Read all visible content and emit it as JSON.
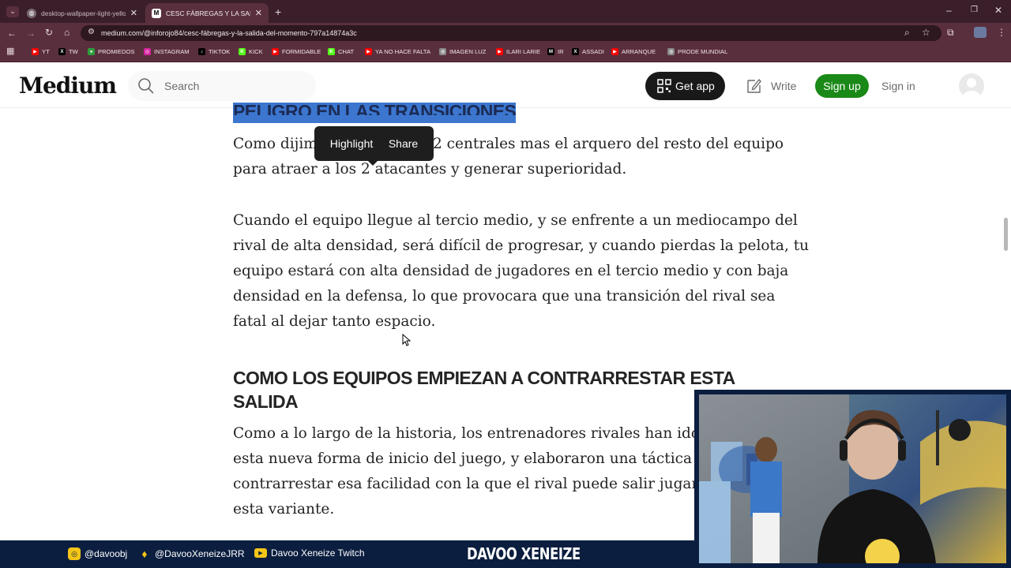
{
  "browser": {
    "tabs": [
      {
        "title": "desktop-wallpaper-light-yellow-aesthetic",
        "active": false
      },
      {
        "title": "CESC FÁBREGAS Y LA SALIDA DEL MOMENTO",
        "active": true
      }
    ],
    "url": "medium.com/@inforojo84/cesc-fábregas-y-la-salida-del-momento-797a14874a3c",
    "bookmarks": [
      {
        "label": "YT",
        "icon": "youtube-icon",
        "color": "#ff0000"
      },
      {
        "label": "TW",
        "icon": "x-icon",
        "color": "#000000"
      },
      {
        "label": "PROMIEDOS",
        "icon": "promiedos-icon",
        "color": "#2e9e3c"
      },
      {
        "label": "INSTAGRAM",
        "icon": "instagram-icon",
        "color": "#d6249f"
      },
      {
        "label": "TIKTOK",
        "icon": "tiktok-icon",
        "color": "#000000"
      },
      {
        "label": "KICK",
        "icon": "kick-icon",
        "color": "#53fc18"
      },
      {
        "label": "FORMIDABLE",
        "icon": "youtube-icon",
        "color": "#ff0000"
      },
      {
        "label": "CHAT",
        "icon": "kick-icon",
        "color": "#53fc18"
      },
      {
        "label": "YA NO HACE FALTA",
        "icon": "youtube-icon",
        "color": "#ff0000"
      },
      {
        "label": "IMAGEN LUZ",
        "icon": "globe-icon",
        "color": "#888888"
      },
      {
        "label": "ILARI LARIE",
        "icon": "youtube-icon",
        "color": "#ff0000"
      },
      {
        "label": "IR",
        "icon": "medium-icon",
        "color": "#000000"
      },
      {
        "label": "ASSADI",
        "icon": "x-icon",
        "color": "#000000"
      },
      {
        "label": "ARRANQUE",
        "icon": "youtube-icon",
        "color": "#ff0000"
      },
      {
        "label": "PRODE MUNDIAL",
        "icon": "globe-icon",
        "color": "#888888"
      }
    ]
  },
  "medium": {
    "logo": "Medium",
    "search_placeholder": "Search",
    "get_app": "Get app",
    "write": "Write",
    "sign_up": "Sign up",
    "sign_in": "Sign in",
    "brand_green": "#1a8917"
  },
  "article": {
    "highlighted_heading": "PELIGRO EN LAS TRANSICIONES",
    "popover": {
      "highlight": "Highlight",
      "share": "Share"
    },
    "p1": [
      "Como dijimos, se separan los 2 centrales mas el arquero del resto del equipo",
      "para atraer a los 2 atacantes y generar superioridad."
    ],
    "p1_visible_start": "Como dijim",
    "p1_visible_end": " 2 centrales mas el arquero del resto del equipo",
    "p2": [
      "Cuando el equipo llegue al tercio medio, y se enfrente a un mediocampo del",
      "rival de alta densidad, será difícil de progresar, y cuando pierdas la pelota, tu",
      "equipo estará con alta densidad de jugadores en el tercio medio y con baja",
      "densidad en la defensa, lo que provocara que una transición del rival sea",
      "fatal al dejar tanto espacio."
    ],
    "heading2_line1": "COMO LOS EQUIPOS EMPIEZAN A CONTRARRESTAR ESTA",
    "heading2_line2": "SALIDA",
    "p3": [
      "Como a lo largo de la historia, los entrenadores rivales han ido estu",
      "esta nueva forma de inicio del juego, y elaboraron una táctica que",
      "contrarrestar esa facilidad con la que el rival puede salir jugando m",
      "esta variante."
    ]
  },
  "overlay": {
    "instagram": "@davoobj",
    "twitter": "@DavooXeneizeJRR",
    "twitch": "Davoo Xeneize Twitch",
    "brand": "DAVOO XENEIZE",
    "bar_color": "#0b1e3f"
  }
}
